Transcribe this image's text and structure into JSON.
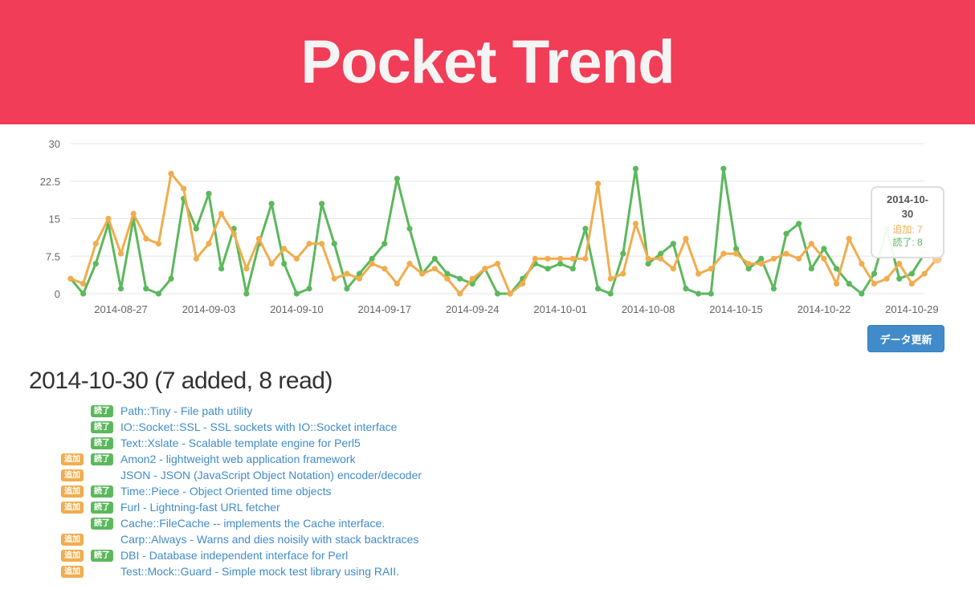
{
  "header": {
    "title": "Pocket Trend"
  },
  "colors": {
    "header_bg": "#f13d57",
    "added": "#f0ad4e",
    "read": "#5cb85c",
    "link": "#428bca",
    "button": "#428bca"
  },
  "chart_data": {
    "type": "line",
    "x_start": "2014-08-23",
    "x_end": "2014-10-30",
    "x_tick_labels": [
      "2014-08-27",
      "2014-09-03",
      "2014-09-10",
      "2014-09-17",
      "2014-09-24",
      "2014-10-01",
      "2014-10-08",
      "2014-10-15",
      "2014-10-22",
      "2014-10-29"
    ],
    "x_tick_dates": [
      "2014-08-27",
      "2014-09-03",
      "2014-09-10",
      "2014-09-17",
      "2014-09-24",
      "2014-10-01",
      "2014-10-08",
      "2014-10-15",
      "2014-10-22",
      "2014-10-29"
    ],
    "y_tick_labels": [
      "0",
      "7.5",
      "15",
      "22.5",
      "30"
    ],
    "y_ticks": [
      0,
      7.5,
      15,
      22.5,
      30
    ],
    "ylim": [
      0,
      30
    ],
    "grid": true,
    "series": [
      {
        "name": "追加",
        "color": "#f0ad4e",
        "values": [
          3,
          2,
          10,
          15,
          8,
          16,
          11,
          10,
          24,
          21,
          7,
          10,
          16,
          12,
          5,
          11,
          6,
          9,
          7,
          10,
          10,
          3,
          4,
          3,
          6,
          5,
          2,
          6,
          4,
          5,
          3,
          0,
          3,
          5,
          6,
          0,
          2,
          7,
          7,
          7,
          7,
          7,
          22,
          3,
          4,
          14,
          7,
          7,
          5,
          11,
          4,
          5,
          8,
          8,
          6,
          6,
          7,
          8,
          7,
          10,
          7,
          2,
          11,
          6,
          2,
          3,
          6,
          2,
          4,
          7
        ]
      },
      {
        "name": "読了",
        "color": "#5cb85c",
        "values": [
          3,
          0,
          6,
          14,
          1,
          15,
          1,
          0,
          3,
          19,
          13,
          20,
          5,
          13,
          0,
          10,
          18,
          6,
          0,
          1,
          18,
          10,
          1,
          4,
          7,
          10,
          23,
          13,
          4,
          7,
          4,
          3,
          2,
          5,
          0,
          0,
          3,
          6,
          5,
          6,
          5,
          13,
          1,
          0,
          8,
          25,
          6,
          8,
          10,
          1,
          0,
          0,
          25,
          9,
          5,
          7,
          1,
          12,
          14,
          5,
          9,
          5,
          2,
          0,
          4,
          13,
          3,
          4,
          8
        ]
      }
    ]
  },
  "tooltip": {
    "date": "2014-10-30",
    "added": "追加: 7",
    "read": "読了: 8"
  },
  "actions": {
    "refresh_label": "データ更新"
  },
  "day": {
    "heading": "2014-10-30 (7 added, 8 read)",
    "badge_added": "追加",
    "badge_read": "読了",
    "entries": [
      {
        "added": false,
        "read": true,
        "text": "Path::Tiny - File path utility"
      },
      {
        "added": false,
        "read": true,
        "text": "IO::Socket::SSL - SSL sockets with IO::Socket interface"
      },
      {
        "added": false,
        "read": true,
        "text": "Text::Xslate - Scalable template engine for Perl5"
      },
      {
        "added": true,
        "read": true,
        "text": "Amon2 - lightweight web application framework"
      },
      {
        "added": true,
        "read": false,
        "text": "JSON - JSON (JavaScript Object Notation) encoder/decoder"
      },
      {
        "added": true,
        "read": true,
        "text": "Time::Piece - Object Oriented time objects"
      },
      {
        "added": true,
        "read": true,
        "text": "Furl - Lightning-fast URL fetcher"
      },
      {
        "added": false,
        "read": true,
        "text": "Cache::FileCache -- implements the Cache interface."
      },
      {
        "added": true,
        "read": false,
        "text": "Carp::Always - Warns and dies noisily with stack backtraces"
      },
      {
        "added": true,
        "read": true,
        "text": "DBI - Database independent interface for Perl"
      },
      {
        "added": true,
        "read": false,
        "text": "Test::Mock::Guard - Simple mock test library using RAII."
      }
    ]
  }
}
